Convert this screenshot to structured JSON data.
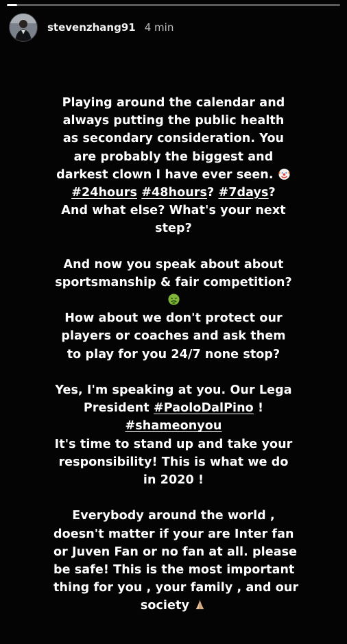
{
  "story": {
    "progress_fraction": 0.03,
    "username": "stevenzhang91",
    "timestamp": "4 min",
    "emoji_icons": [
      "clown-face-emoji",
      "nauseated-face-emoji",
      "folded-hands-emoji"
    ]
  },
  "text": {
    "p1_l1": "Playing around the calendar and",
    "p1_l2": "always putting the public health",
    "p1_l3": "as secondary consideration. You",
    "p1_l4": "are probably the biggest and",
    "p1_l5": "darkest clown I have ever seen.",
    "tag_24hours": "#24hours",
    "tag_48hours": "#48hours",
    "qmark_1": "?",
    "tag_7days": "#7days",
    "qmark_2": "?",
    "p1_l7": "And what else?  What's your next",
    "p1_l8": "step?",
    "p2_l1": "And now you speak about about",
    "p2_l2": "sportsmanship & fair competition?",
    "p2_l4": "How about we don't protect our",
    "p2_l5": "players or coaches and ask them",
    "p2_l6": "to play for you 24/7 none stop?",
    "p3_l1": "Yes, I'm speaking at you. Our Lega",
    "p3_l2_prefix": "President",
    "tag_paolo": "#PaoloDalPino",
    "p3_l2_suffix": "!",
    "tag_shame": "#shameonyou",
    "p3_l4": "It's time to stand up and take your",
    "p3_l5": "responsibility!  This is what we do",
    "p3_l6": "in 2020 !",
    "p4_l1": "Everybody around the world ,",
    "p4_l2": "doesn't matter if your are Inter fan",
    "p4_l3": "or Juven Fan or no fan at all. please",
    "p4_l4": "be safe! This is the most important",
    "p4_l5": "thing for you , your family , and our",
    "p4_l6": "society"
  },
  "colors": {
    "background": "#050404",
    "text": "#ffffff",
    "timestamp": "#bdbdbd"
  }
}
